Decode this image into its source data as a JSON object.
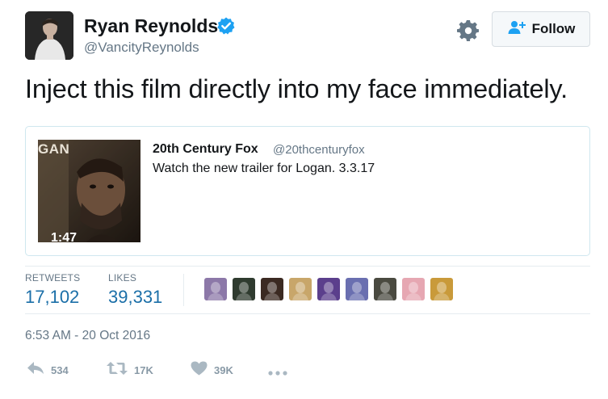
{
  "author": {
    "name": "Ryan Reynolds",
    "handle": "@VancityReynolds",
    "verified": true
  },
  "header": {
    "follow_label": "Follow"
  },
  "tweet": {
    "text": "Inject this film directly into my face immediately."
  },
  "quoted_tweet": {
    "name": "20th Century Fox",
    "handle": "@20thcenturyfox",
    "text": "Watch the new trailer for Logan. 3.3.17",
    "video_duration": "1:47",
    "thumb_title_fragment": "GAN"
  },
  "stats": {
    "retweets_label": "RETWEETS",
    "retweets_value": "17,102",
    "likes_label": "LIKES",
    "likes_value": "39,331"
  },
  "likers": [
    {
      "name": "liker-avatar-1",
      "color": "#8c78a8"
    },
    {
      "name": "liker-avatar-2",
      "color": "#2f3b2f"
    },
    {
      "name": "liker-avatar-3",
      "color": "#3b2a22"
    },
    {
      "name": "liker-avatar-4",
      "color": "#c8a66a"
    },
    {
      "name": "liker-avatar-5",
      "color": "#5b3f8c"
    },
    {
      "name": "liker-avatar-6",
      "color": "#6a6fb0"
    },
    {
      "name": "liker-avatar-7",
      "color": "#4a4a40"
    },
    {
      "name": "liker-avatar-8",
      "color": "#e6a7b2"
    },
    {
      "name": "liker-avatar-9",
      "color": "#c99a3a"
    }
  ],
  "timestamp": "6:53 AM - 20 Oct 2016",
  "actions": {
    "reply_count": "534",
    "retweet_count": "17K",
    "like_count": "39K"
  },
  "colors": {
    "verified_blue": "#1da1f2",
    "link_blue": "#1b6fa8",
    "muted_gray": "#657786",
    "icon_gray": "#aab8c2"
  }
}
